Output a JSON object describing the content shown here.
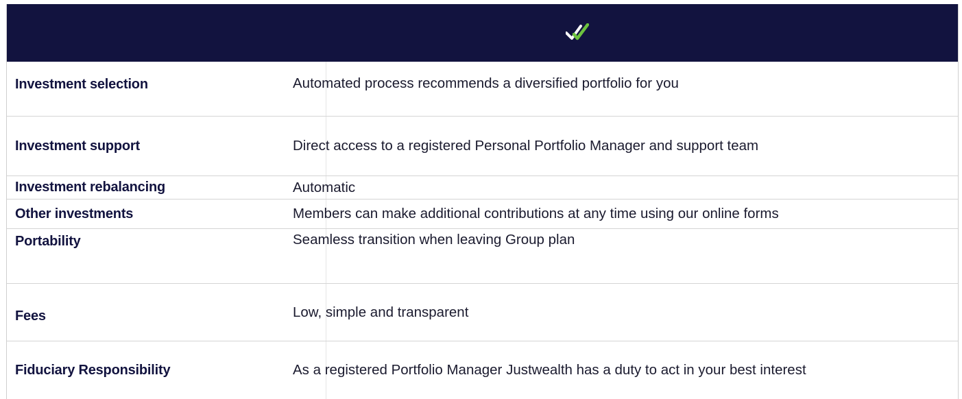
{
  "header": {
    "icon": "double-check-icon",
    "icon_colors": {
      "white": "#ffffff",
      "green": "#6dc23f"
    },
    "background": "#12133f"
  },
  "rows": [
    {
      "label": "Investment selection",
      "value": "Automated process recommends a diversified portfolio for you"
    },
    {
      "label": "Investment support",
      "value": "Direct access to a registered Personal Portfolio Manager and support team"
    },
    {
      "label": "Investment rebalancing",
      "value": "Automatic"
    },
    {
      "label": "Other investments",
      "value": "Members can make additional contributions at any time using our online forms"
    },
    {
      "label": "Portability",
      "value": "Seamless transition when leaving Group plan"
    },
    {
      "label": "Fees",
      "value": "Low, simple and transparent"
    },
    {
      "label": "Fiduciary Responsibility",
      "value": "As a registered Portfolio Manager Justwealth has a duty to act in your best interest"
    }
  ]
}
